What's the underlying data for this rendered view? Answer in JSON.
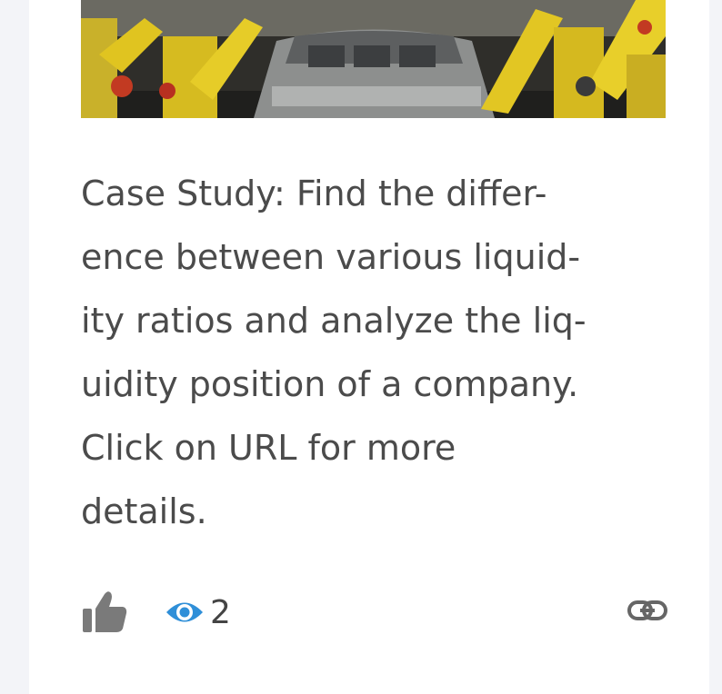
{
  "card": {
    "image_alt": "car-assembly-robots",
    "description_lines": [
      "Case Study: Find the differ-",
      "ence between various liquid-",
      "ity ratios and analyze the liq-",
      "uidity position of a company.",
      "Click on URL for more",
      "details."
    ],
    "view_count": "2"
  },
  "icons": {
    "like": "thumbs-up-icon",
    "views": "eye-icon",
    "link": "link-icon"
  },
  "colors": {
    "text": "#4b4b4b",
    "like_icon": "#7a7a7a",
    "eye_icon": "#2f8fd8",
    "link_icon": "#666666"
  }
}
